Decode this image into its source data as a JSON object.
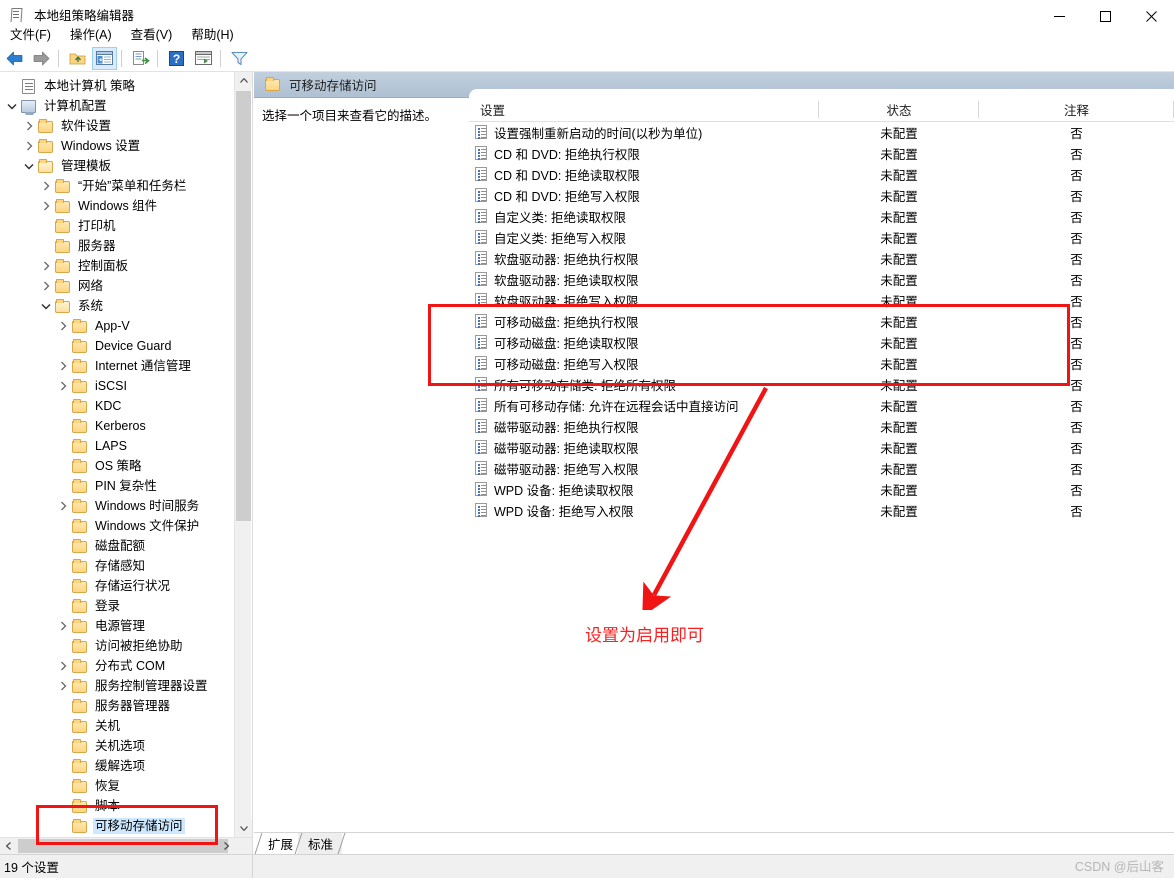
{
  "window": {
    "title": "本地组策略编辑器",
    "icon": "policy-editor-icon",
    "minimize_label": "—",
    "maximize_label": "□",
    "close_label": "✕"
  },
  "menubar": {
    "items": [
      {
        "label": "文件(F)",
        "name": "menu-file"
      },
      {
        "label": "操作(A)",
        "name": "menu-action"
      },
      {
        "label": "查看(V)",
        "name": "menu-view"
      },
      {
        "label": "帮助(H)",
        "name": "menu-help"
      }
    ]
  },
  "toolbar": {
    "buttons": [
      {
        "name": "back-icon",
        "title": "后退"
      },
      {
        "name": "forward-icon",
        "title": "前进"
      },
      {
        "name": "up-folder-icon",
        "title": "上一级"
      },
      {
        "name": "show-hide-tree-icon",
        "title": "显示/隐藏控制台树",
        "active": true
      },
      {
        "name": "export-list-icon",
        "title": "导出列表"
      },
      {
        "name": "help-icon",
        "title": "帮助"
      },
      {
        "name": "properties-icon",
        "title": "属性"
      },
      {
        "name": "filter-icon",
        "title": "筛选器"
      }
    ]
  },
  "tree": {
    "root": "本地计算机 策略",
    "items": [
      {
        "label": "本地计算机 策略",
        "indent": 0,
        "twist": "",
        "icon": "policy-scroll-icon",
        "selected": false
      },
      {
        "label": "计算机配置",
        "indent": 0,
        "twist": "down",
        "icon": "computer-icon",
        "selected": false
      },
      {
        "label": "软件设置",
        "indent": 1,
        "twist": "right",
        "icon": "folder-icon",
        "selected": false
      },
      {
        "label": "Windows 设置",
        "indent": 1,
        "twist": "right",
        "icon": "folder-icon",
        "selected": false
      },
      {
        "label": "管理模板",
        "indent": 1,
        "twist": "down",
        "icon": "folder-icon",
        "selected": false
      },
      {
        "label": "“开始”菜单和任务栏",
        "indent": 2,
        "twist": "right",
        "icon": "folder-icon",
        "selected": false
      },
      {
        "label": "Windows 组件",
        "indent": 2,
        "twist": "right",
        "icon": "folder-icon",
        "selected": false
      },
      {
        "label": "打印机",
        "indent": 2,
        "twist": "",
        "icon": "folder-icon",
        "selected": false
      },
      {
        "label": "服务器",
        "indent": 2,
        "twist": "",
        "icon": "folder-icon",
        "selected": false
      },
      {
        "label": "控制面板",
        "indent": 2,
        "twist": "right",
        "icon": "folder-icon",
        "selected": false
      },
      {
        "label": "网络",
        "indent": 2,
        "twist": "right",
        "icon": "folder-icon",
        "selected": false
      },
      {
        "label": "系统",
        "indent": 2,
        "twist": "down",
        "icon": "folder-icon",
        "selected": false
      },
      {
        "label": "App-V",
        "indent": 3,
        "twist": "right",
        "icon": "folder-icon",
        "selected": false
      },
      {
        "label": "Device Guard",
        "indent": 3,
        "twist": "",
        "icon": "folder-icon",
        "selected": false
      },
      {
        "label": "Internet 通信管理",
        "indent": 3,
        "twist": "right",
        "icon": "folder-icon",
        "selected": false
      },
      {
        "label": "iSCSI",
        "indent": 3,
        "twist": "right",
        "icon": "folder-icon",
        "selected": false
      },
      {
        "label": "KDC",
        "indent": 3,
        "twist": "",
        "icon": "folder-icon",
        "selected": false
      },
      {
        "label": "Kerberos",
        "indent": 3,
        "twist": "",
        "icon": "folder-icon",
        "selected": false
      },
      {
        "label": "LAPS",
        "indent": 3,
        "twist": "",
        "icon": "folder-icon",
        "selected": false
      },
      {
        "label": "OS 策略",
        "indent": 3,
        "twist": "",
        "icon": "folder-icon",
        "selected": false
      },
      {
        "label": "PIN 复杂性",
        "indent": 3,
        "twist": "",
        "icon": "folder-icon",
        "selected": false
      },
      {
        "label": "Windows 时间服务",
        "indent": 3,
        "twist": "right",
        "icon": "folder-icon",
        "selected": false
      },
      {
        "label": "Windows 文件保护",
        "indent": 3,
        "twist": "",
        "icon": "folder-icon",
        "selected": false
      },
      {
        "label": "磁盘配额",
        "indent": 3,
        "twist": "",
        "icon": "folder-icon",
        "selected": false
      },
      {
        "label": "存储感知",
        "indent": 3,
        "twist": "",
        "icon": "folder-icon",
        "selected": false
      },
      {
        "label": "存储运行状况",
        "indent": 3,
        "twist": "",
        "icon": "folder-icon",
        "selected": false
      },
      {
        "label": "登录",
        "indent": 3,
        "twist": "",
        "icon": "folder-icon",
        "selected": false
      },
      {
        "label": "电源管理",
        "indent": 3,
        "twist": "right",
        "icon": "folder-icon",
        "selected": false
      },
      {
        "label": "访问被拒绝协助",
        "indent": 3,
        "twist": "",
        "icon": "folder-icon",
        "selected": false
      },
      {
        "label": "分布式 COM",
        "indent": 3,
        "twist": "right",
        "icon": "folder-icon",
        "selected": false
      },
      {
        "label": "服务控制管理器设置",
        "indent": 3,
        "twist": "right",
        "icon": "folder-icon",
        "selected": false
      },
      {
        "label": "服务器管理器",
        "indent": 3,
        "twist": "",
        "icon": "folder-icon",
        "selected": false
      },
      {
        "label": "关机",
        "indent": 3,
        "twist": "",
        "icon": "folder-icon",
        "selected": false
      },
      {
        "label": "关机选项",
        "indent": 3,
        "twist": "",
        "icon": "folder-icon",
        "selected": false
      },
      {
        "label": "缓解选项",
        "indent": 3,
        "twist": "",
        "icon": "folder-icon",
        "selected": false
      },
      {
        "label": "恢复",
        "indent": 3,
        "twist": "",
        "icon": "folder-icon",
        "selected": false
      },
      {
        "label": "脚本",
        "indent": 3,
        "twist": "",
        "icon": "folder-icon",
        "selected": false
      },
      {
        "label": "可移动存储访问",
        "indent": 3,
        "twist": "",
        "icon": "folder-icon",
        "selected": true
      }
    ]
  },
  "right_panel": {
    "header_title": "可移动存储访问",
    "header_icon": "folder-icon",
    "description": "选择一个项目来查看它的描述。",
    "columns": [
      "设置",
      "状态",
      "注释"
    ],
    "rows": [
      {
        "setting": "设置强制重新启动的时间(以秒为单位)",
        "state": "未配置",
        "comment": "否"
      },
      {
        "setting": "CD 和 DVD: 拒绝执行权限",
        "state": "未配置",
        "comment": "否"
      },
      {
        "setting": "CD 和 DVD: 拒绝读取权限",
        "state": "未配置",
        "comment": "否"
      },
      {
        "setting": "CD 和 DVD: 拒绝写入权限",
        "state": "未配置",
        "comment": "否"
      },
      {
        "setting": "自定义类: 拒绝读取权限",
        "state": "未配置",
        "comment": "否"
      },
      {
        "setting": "自定义类: 拒绝写入权限",
        "state": "未配置",
        "comment": "否"
      },
      {
        "setting": "软盘驱动器: 拒绝执行权限",
        "state": "未配置",
        "comment": "否"
      },
      {
        "setting": "软盘驱动器: 拒绝读取权限",
        "state": "未配置",
        "comment": "否"
      },
      {
        "setting": "软盘驱动器: 拒绝写入权限",
        "state": "未配置",
        "comment": "否"
      },
      {
        "setting": "可移动磁盘: 拒绝执行权限",
        "state": "未配置",
        "comment": "否"
      },
      {
        "setting": "可移动磁盘: 拒绝读取权限",
        "state": "未配置",
        "comment": "否"
      },
      {
        "setting": "可移动磁盘: 拒绝写入权限",
        "state": "未配置",
        "comment": "否"
      },
      {
        "setting": "所有可移动存储类: 拒绝所有权限",
        "state": "未配置",
        "comment": "否"
      },
      {
        "setting": "所有可移动存储: 允许在远程会话中直接访问",
        "state": "未配置",
        "comment": "否"
      },
      {
        "setting": "磁带驱动器: 拒绝执行权限",
        "state": "未配置",
        "comment": "否"
      },
      {
        "setting": "磁带驱动器: 拒绝读取权限",
        "state": "未配置",
        "comment": "否"
      },
      {
        "setting": "磁带驱动器: 拒绝写入权限",
        "state": "未配置",
        "comment": "否"
      },
      {
        "setting": "WPD 设备: 拒绝读取权限",
        "state": "未配置",
        "comment": "否"
      },
      {
        "setting": "WPD 设备: 拒绝写入权限",
        "state": "未配置",
        "comment": "否"
      }
    ]
  },
  "tabs": [
    {
      "label": "扩展",
      "active": true
    },
    {
      "label": "标准",
      "active": false
    }
  ],
  "statusbar": {
    "text": "19 个设置"
  },
  "annotations": {
    "callout_text": "设置为启用即可",
    "color": "#f01414"
  },
  "watermark": {
    "text": "CSDN @后山客"
  }
}
